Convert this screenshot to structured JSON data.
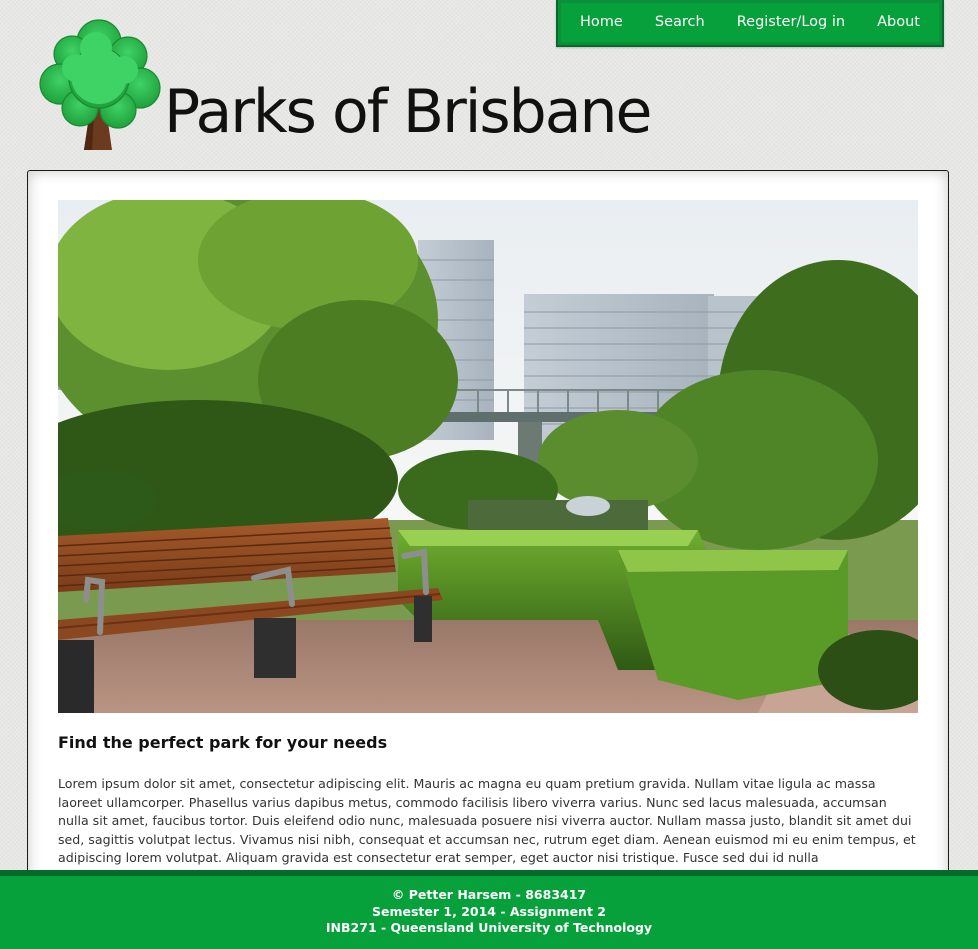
{
  "nav": {
    "items": [
      {
        "label": "Home"
      },
      {
        "label": "Search"
      },
      {
        "label": "Register/Log in"
      },
      {
        "label": "About"
      }
    ]
  },
  "header": {
    "title": "Parks of Brisbane",
    "logo_icon": "tree-icon"
  },
  "main": {
    "hero_image": "park-bench-garden-photo",
    "heading": "Find the perfect park for your needs",
    "body": "Lorem ipsum dolor sit amet, consectetur adipiscing elit. Mauris ac magna eu quam pretium gravida. Nullam vitae ligula ac massa laoreet ullamcorper. Phasellus varius dapibus metus, commodo facilisis libero viverra varius. Nunc sed lacus malesuada, accumsan nulla sit amet, faucibus tortor. Duis eleifend odio nunc, malesuada posuere nisi viverra auctor. Nullam massa justo, blandit sit amet dui sed, sagittis volutpat lectus. Vivamus nisi nibh, consequat et accumsan nec, rutrum eget diam. Aenean euismod mi eu enim tempus, et adipiscing lorem volutpat. Aliquam gravida est consectetur erat semper, eget auctor nisi tristique. Fusce sed dui id nulla"
  },
  "footer": {
    "line1": "© Petter Harsem - 8683417",
    "line2": "Semester 1, 2014 - Assignment 2",
    "line3": "INB271 - Queensland University of Technology"
  },
  "colors": {
    "brand_green": "#07a13c",
    "brand_green_dark": "#056a2b",
    "tree_green": "#2fbf4e",
    "trunk_brown": "#6b3a1f"
  }
}
